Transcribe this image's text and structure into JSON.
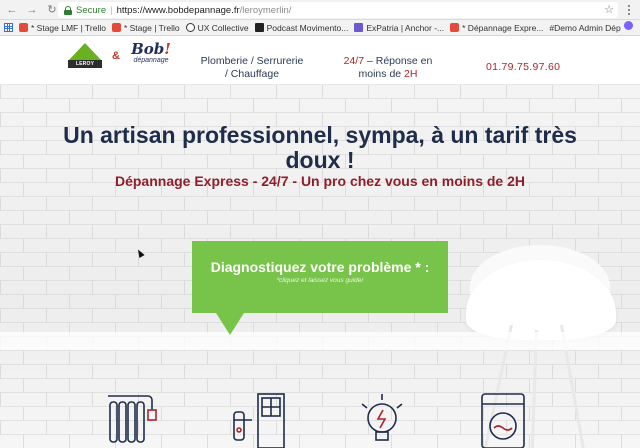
{
  "browser": {
    "secure_label": "Secure",
    "url_domain": "https://www.bobdepannage.fr",
    "url_path": "/leroymerlin/",
    "bookmarks": [
      {
        "label": "* Stage LMF | Trello"
      },
      {
        "label": "* Stage | Trello"
      },
      {
        "label": "UX Collective"
      },
      {
        "label": "Podcast Movimento..."
      },
      {
        "label": "ExPatria | Anchor -..."
      },
      {
        "label": "* Dépannage Expre..."
      },
      {
        "label": "#Demo Admin Dép"
      }
    ]
  },
  "header": {
    "lm_logo_text": "LEROY MERLIN",
    "amp": "&",
    "bob_word": "Bob",
    "bob_excl": "!",
    "bob_sub": "dépannage",
    "nav_line1": "Plomberie / Serrurerie",
    "nav_line2": "/ Chauffage",
    "h247_red": "24/7",
    "h247_rest": " – Réponse en",
    "h247_line2_a": "moins de ",
    "h247_line2_b": "2H",
    "phone": "01.79.75.97.60"
  },
  "hero": {
    "title_line1": "Un artisan professionnel, sympa, à un tarif très",
    "title_line2": "doux !",
    "subtitle": "Dépannage Express - 24/7 - Un pro chez vous en moins de 2H",
    "cta_title": "Diagnostiquez votre problème * :",
    "cta_hint": "*cliquez et laissez vous guider"
  },
  "colors": {
    "accent_green": "#78c44a",
    "title_navy": "#1f2d4a",
    "accent_red": "#8e1f2a"
  },
  "services": [
    {
      "icon": "radiator-icon"
    },
    {
      "icon": "door-lock-icon"
    },
    {
      "icon": "lightbulb-icon"
    },
    {
      "icon": "washing-machine-icon"
    }
  ]
}
